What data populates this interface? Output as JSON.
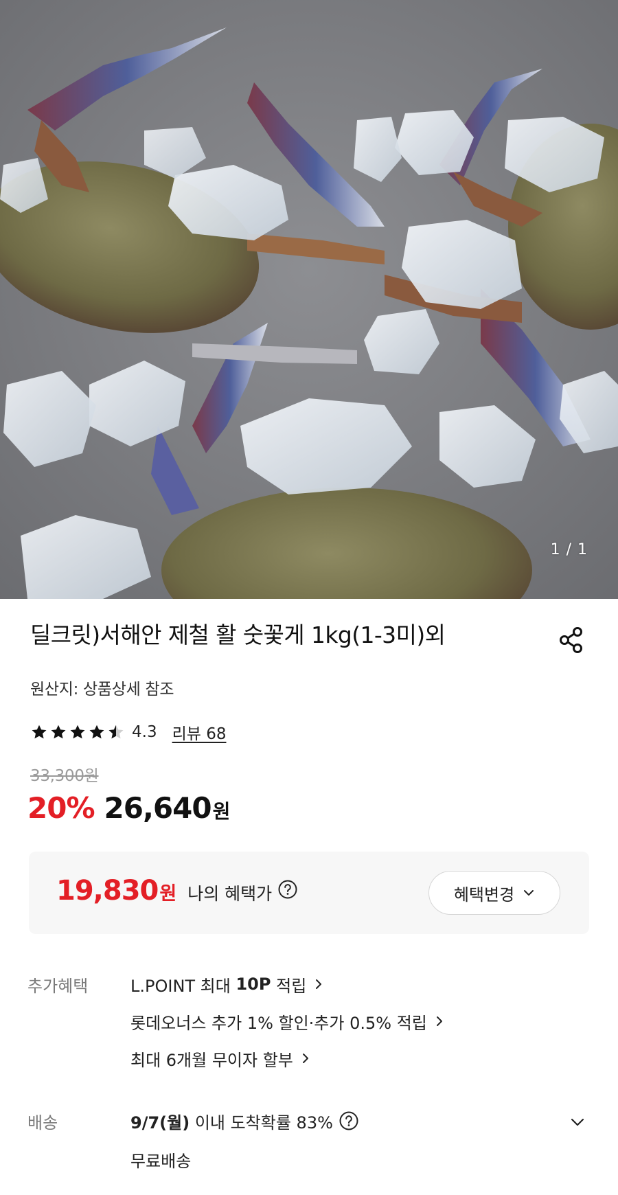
{
  "hero": {
    "counter": "1 / 1"
  },
  "product": {
    "title": "딜크릿)서해안 제철 활 숫꽃게 1kg(1-3미)외",
    "origin": "원산지: 상품상세 참조",
    "rating": "4.3",
    "rating_value": 4.3,
    "review_label": "리뷰 68"
  },
  "price": {
    "original": "33,300원",
    "discount": "20%",
    "current": "26,640",
    "currency": "원"
  },
  "benefit": {
    "price": "19,830",
    "currency": "원",
    "label": "나의 혜택가",
    "button": "혜택변경"
  },
  "extra": {
    "label": "추가혜택",
    "items": [
      {
        "pre": "L.POINT 최대 ",
        "bold": "10P",
        "post": " 적립"
      },
      {
        "pre": "롯데오너스 추가 1% 할인·추가 0.5% 적립",
        "bold": "",
        "post": ""
      },
      {
        "pre": "최대 6개월 무이자 할부",
        "bold": "",
        "post": ""
      }
    ]
  },
  "shipping": {
    "label": "배송",
    "date": "9/7(월)",
    "info": " 이내 도착확률 83%",
    "fee": "무료배송"
  },
  "colors": {
    "accent_red": "#e31f26",
    "text": "#111111",
    "muted": "#7a7a7a",
    "panel": "#f7f7f7"
  },
  "icons": [
    "share-icon",
    "star-icon",
    "help-icon",
    "chevron-down-icon",
    "chevron-right-icon"
  ]
}
